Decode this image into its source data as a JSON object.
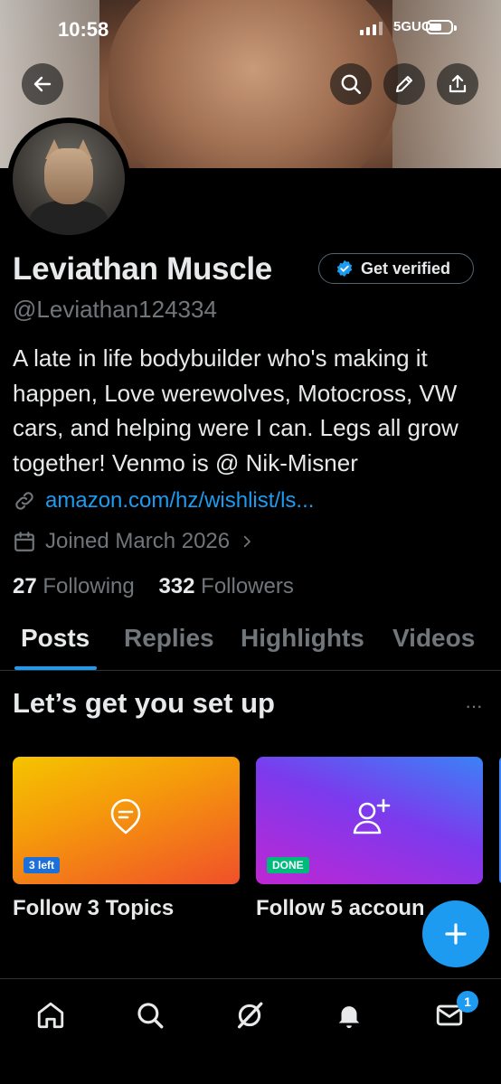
{
  "status_bar": {
    "time": "10:58",
    "network": "5GUC"
  },
  "profile": {
    "name": "Leviathan Muscle",
    "verify_button": "Get verified",
    "handle": "@Leviathan124334",
    "bio": "A late in life bodybuilder who's making it happen, Love werewolves, Motocross, VW cars, and helping were I can. Legs all grow together! Venmo is @ Nik-Misner",
    "link": "amazon.com/hz/wishlist/ls...",
    "joined": "Joined March 2026",
    "following_count": "27",
    "following_label": "Following",
    "followers_count": "332",
    "followers_label": "Followers"
  },
  "header_buttons": [
    "back-arrow-icon",
    "search-icon",
    "pencil-icon",
    "share-icon"
  ],
  "tabs": [
    {
      "label": "Posts",
      "active": true
    },
    {
      "label": "Replies",
      "active": false
    },
    {
      "label": "Highlights",
      "active": false
    },
    {
      "label": "Videos",
      "active": false
    }
  ],
  "setup": {
    "title": "Let’s get you set up",
    "more": "···",
    "cards": [
      {
        "title": "Follow 3 Topics",
        "badge": "3 left",
        "icon": "topic-bubble-icon"
      },
      {
        "title": "Follow 5 accounts",
        "badge": "DONE",
        "icon": "add-person-icon"
      }
    ]
  },
  "fab": "compose-plus-icon",
  "bottom_nav": {
    "items": [
      "home-icon",
      "search-icon",
      "grok-icon",
      "notifications-icon",
      "messages-icon"
    ],
    "messages_badge": "1"
  },
  "colors": {
    "accent": "#1d9bf0",
    "muted": "#71767b",
    "done": "#00ba7c"
  }
}
